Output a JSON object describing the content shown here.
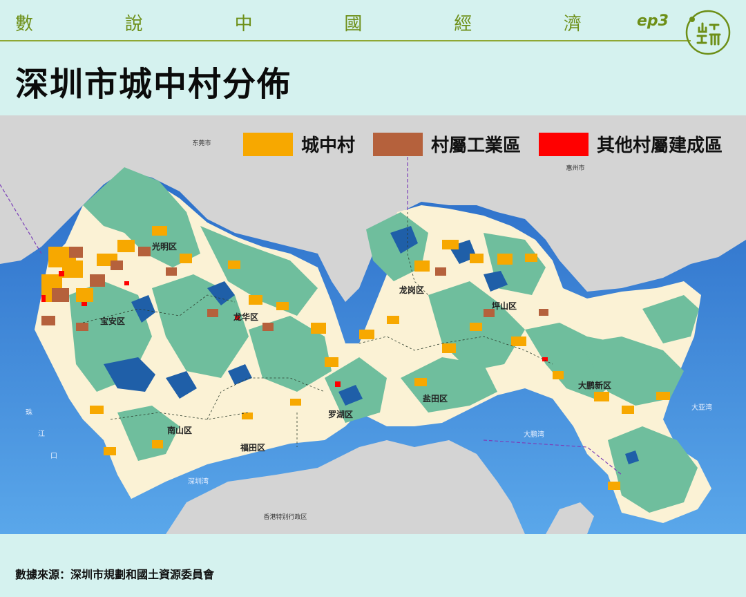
{
  "header": {
    "series_chars": [
      "數",
      "說",
      "中",
      "國",
      "經",
      "濟"
    ],
    "episode": "ep3",
    "title": "深圳市城中村分佈"
  },
  "legend": [
    {
      "label": "城中村",
      "color": "#f7a800"
    },
    {
      "label": "村屬工業區",
      "color": "#b5613c"
    },
    {
      "label": "其他村屬建成區",
      "color": "#ff0000"
    }
  ],
  "map": {
    "city_labels": {
      "dongguan": "东莞市",
      "huizhou": "惠州市",
      "hk": "香港特别行政区"
    },
    "districts": {
      "guangming": "光明区",
      "baoan": "宝安区",
      "longhua": "龙华区",
      "longgang": "龙岗区",
      "pingshan": "坪山区",
      "dapeng": "大鹏新区",
      "yantian": "盐田区",
      "luohu": "罗湖区",
      "nanshan": "南山区",
      "futian": "福田区"
    },
    "water": {
      "pearl_1": "珠",
      "pearl_2": "江",
      "pearl_3": "口",
      "shenzhen_bay": "深圳湾",
      "dapeng_bay": "大鹏湾",
      "daya_bay": "大亚湾"
    },
    "colors": {
      "sea": "#3a86d8",
      "land_outside": "#d4d4d4",
      "urban": "#fbf2d5",
      "green": "#6fbe9d",
      "reservoir": "#1f5fa8"
    }
  },
  "footer": {
    "source": "數據來源：深圳市規劃和國土資源委員會"
  }
}
